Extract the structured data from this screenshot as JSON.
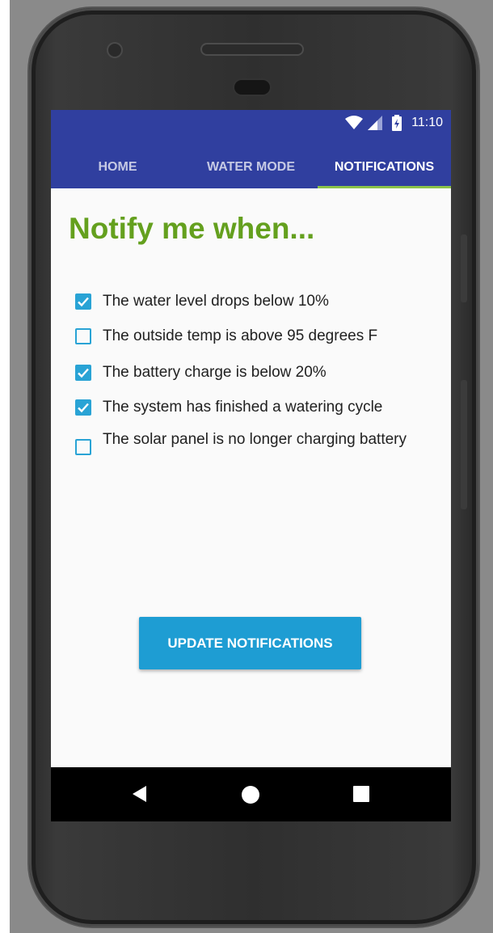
{
  "status_bar": {
    "time": "11:10",
    "icons": [
      "wifi-icon",
      "signal-icon",
      "battery-charging-icon"
    ]
  },
  "tabs": [
    {
      "label": "HOME",
      "active": false
    },
    {
      "label": "WATER MODE",
      "active": false
    },
    {
      "label": "NOTIFICATIONS",
      "active": true
    }
  ],
  "heading": "Notify me when...",
  "options": [
    {
      "label": "The water level drops below 10%",
      "checked": true
    },
    {
      "label": "The outside temp is above 95 degrees F",
      "checked": false
    },
    {
      "label": "The battery charge is below 20%",
      "checked": true
    },
    {
      "label": "The system has finished a watering cycle",
      "checked": true
    },
    {
      "label": "The solar panel is no longer charging battery",
      "checked": false
    }
  ],
  "update_button": "UPDATE NOTIFICATIONS",
  "nav_bar": [
    "back-icon",
    "home-icon",
    "recents-icon"
  ],
  "colors": {
    "app_bar": "#303f9f",
    "tab_indicator": "#8bc34a",
    "heading": "#64a01e",
    "accent": "#29a3d5",
    "button": "#1e9dd3"
  }
}
